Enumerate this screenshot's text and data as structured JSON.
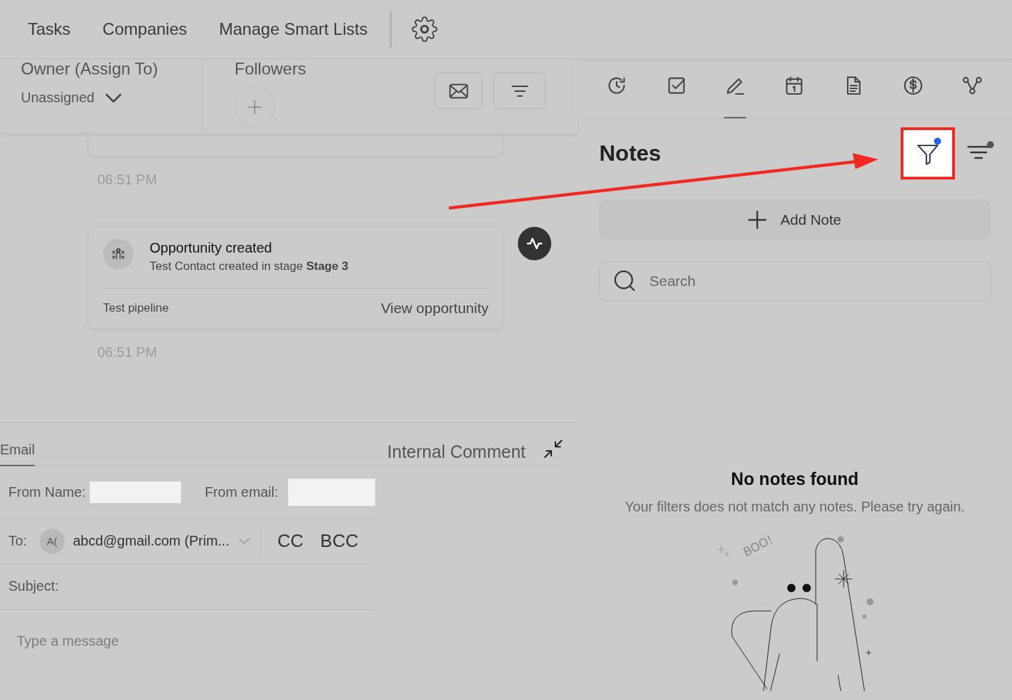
{
  "top_nav": {
    "tabs": [
      {
        "label": "Tasks"
      },
      {
        "label": "Companies"
      },
      {
        "label": "Manage Smart Lists"
      }
    ]
  },
  "owner": {
    "label": "Owner (Assign To)",
    "value": "Unassigned"
  },
  "followers": {
    "label": "Followers"
  },
  "activity": [
    {
      "kind": "card_partial"
    },
    {
      "kind": "time",
      "text": "06:51 PM"
    },
    {
      "kind": "card",
      "title": "Opportunity created",
      "description": "Test Contact created in stage **Stage 3**",
      "pipeline": "Test pipeline",
      "link": "View opportunity"
    },
    {
      "kind": "time",
      "text": "06:51 PM"
    }
  ],
  "composer": {
    "tabs": [
      {
        "label": "Email",
        "selected": true
      },
      {
        "label": "Internal Comment",
        "selected": false
      }
    ],
    "from_name_label": "From Name:",
    "from_email_label": "From email:",
    "to_label": "To:",
    "recipient": {
      "initials": "A(",
      "email": "abcd@gmail.com (Prim..."
    },
    "cc": "CC",
    "bcc": "BCC",
    "subject_label": "Subject:",
    "message": {
      "placeholder": "Type a message"
    }
  },
  "notes_panel": {
    "tabs": [
      {
        "kind": "history",
        "selected": false
      },
      {
        "kind": "tasks",
        "selected": false
      },
      {
        "kind": "notes",
        "selected": true
      },
      {
        "kind": "calendar",
        "selected": false
      },
      {
        "kind": "document",
        "selected": false
      },
      {
        "kind": "payments",
        "selected": false
      },
      {
        "kind": "workflow",
        "selected": false
      }
    ],
    "title": "Notes",
    "filter": {
      "active": true
    },
    "sort": {
      "active": true
    },
    "add_note": "Add Note",
    "search": {
      "placeholder": "Search"
    },
    "empty": {
      "title": "No notes found",
      "message": "Your filters does not match any notes. Please try again.",
      "illustration_text": "BOO!"
    }
  }
}
